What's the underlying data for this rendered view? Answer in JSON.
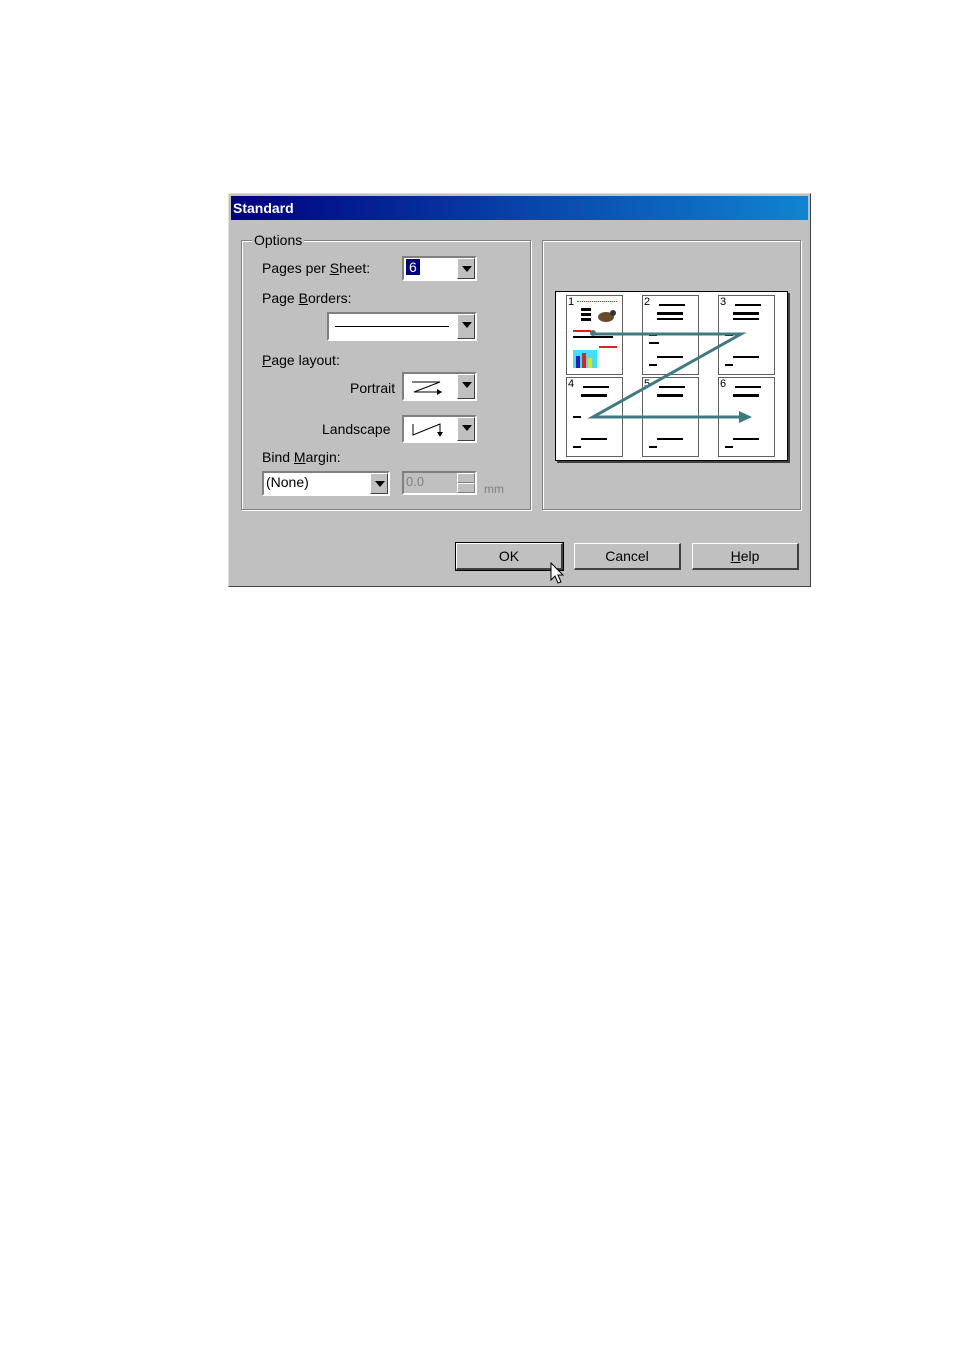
{
  "dialog": {
    "title": "Standard",
    "options_group_label": "Options",
    "pages_per_sheet": {
      "label_pre": "Pages per ",
      "label_u": "S",
      "label_post": "heet:",
      "value": "6"
    },
    "page_borders": {
      "label_pre": "Page ",
      "label_u": "B",
      "label_post": "orders:"
    },
    "page_layout": {
      "label_u": "P",
      "label_post": "age layout:",
      "portrait_label": "Portrait",
      "landscape_label": "Landscape"
    },
    "bind_margin": {
      "label_pre": "Bind ",
      "label_u": "M",
      "label_post": "argin:",
      "value": "(None)",
      "amount": "0.0",
      "unit": "mm"
    },
    "buttons": {
      "ok": "OK",
      "cancel": "Cancel",
      "help_u": "H",
      "help_post": "elp"
    },
    "preview": {
      "page_numbers": [
        "1",
        "2",
        "3",
        "4",
        "5",
        "6"
      ],
      "arrow_color": "#3f7a80"
    }
  }
}
